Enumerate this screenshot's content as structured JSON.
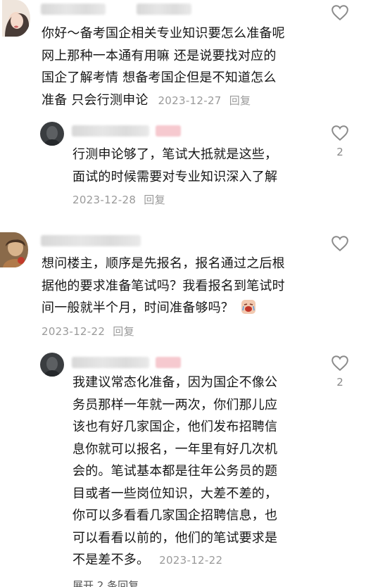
{
  "comments": [
    {
      "avatar_icon": "avatar-woman-photo",
      "text_lines": [
        "你好～备考国企相关专业知识要怎么准备呢",
        "网上那种一本通有用嘛 还是说要找对应的",
        "国企了解考情 想备考国企但是不知道怎么"
      ],
      "text_last": "准备 只会行测申论",
      "date": "2023-12-27",
      "reply_label": "回复",
      "like_count": "",
      "reply": {
        "avatar_icon": "avatar-dark-photo",
        "text_lines": [
          "行测申论够了，笔试大抵就是这些，",
          "面试的时候需要对专业知识深入了解"
        ],
        "date": "2023-12-28",
        "reply_label": "回复",
        "like_count": "2"
      }
    },
    {
      "avatar_icon": "avatar-vintage-photo",
      "text_lines": [
        "想问楼主，顺序是先报名，报名通过之后根",
        "据他的要求准备笔试吗？我看报名到笔试时"
      ],
      "text_last": "间一般就半个月，时间准备够吗？",
      "emoji_icon": "crying-face-emoji",
      "date": "2023-12-22",
      "reply_label": "回复",
      "like_count": "",
      "reply": {
        "avatar_icon": "avatar-dark-photo",
        "text_lines": [
          "我建议常态化准备，因为国企不像公",
          "务员那样一年就一两次，你们那儿应",
          "该也有好几家国企，他们发布招聘信",
          "息你就可以报名，一年里有好几次机",
          "会的。笔试基本都是往年公务员的题",
          "目或者一些岗位知识，大差不差的，",
          "你可以多看看几家国企招聘信息，也",
          "可以看看以前的，他们的笔试要求是"
        ],
        "text_last": "不是差不多。",
        "date": "2023-12-22",
        "like_count": "2"
      }
    }
  ],
  "expand_label": "展开 2 条回复",
  "colors": {
    "meta": "#9a9a9a",
    "tag": "#f6c9cf",
    "heart": "#8a8a8a"
  }
}
